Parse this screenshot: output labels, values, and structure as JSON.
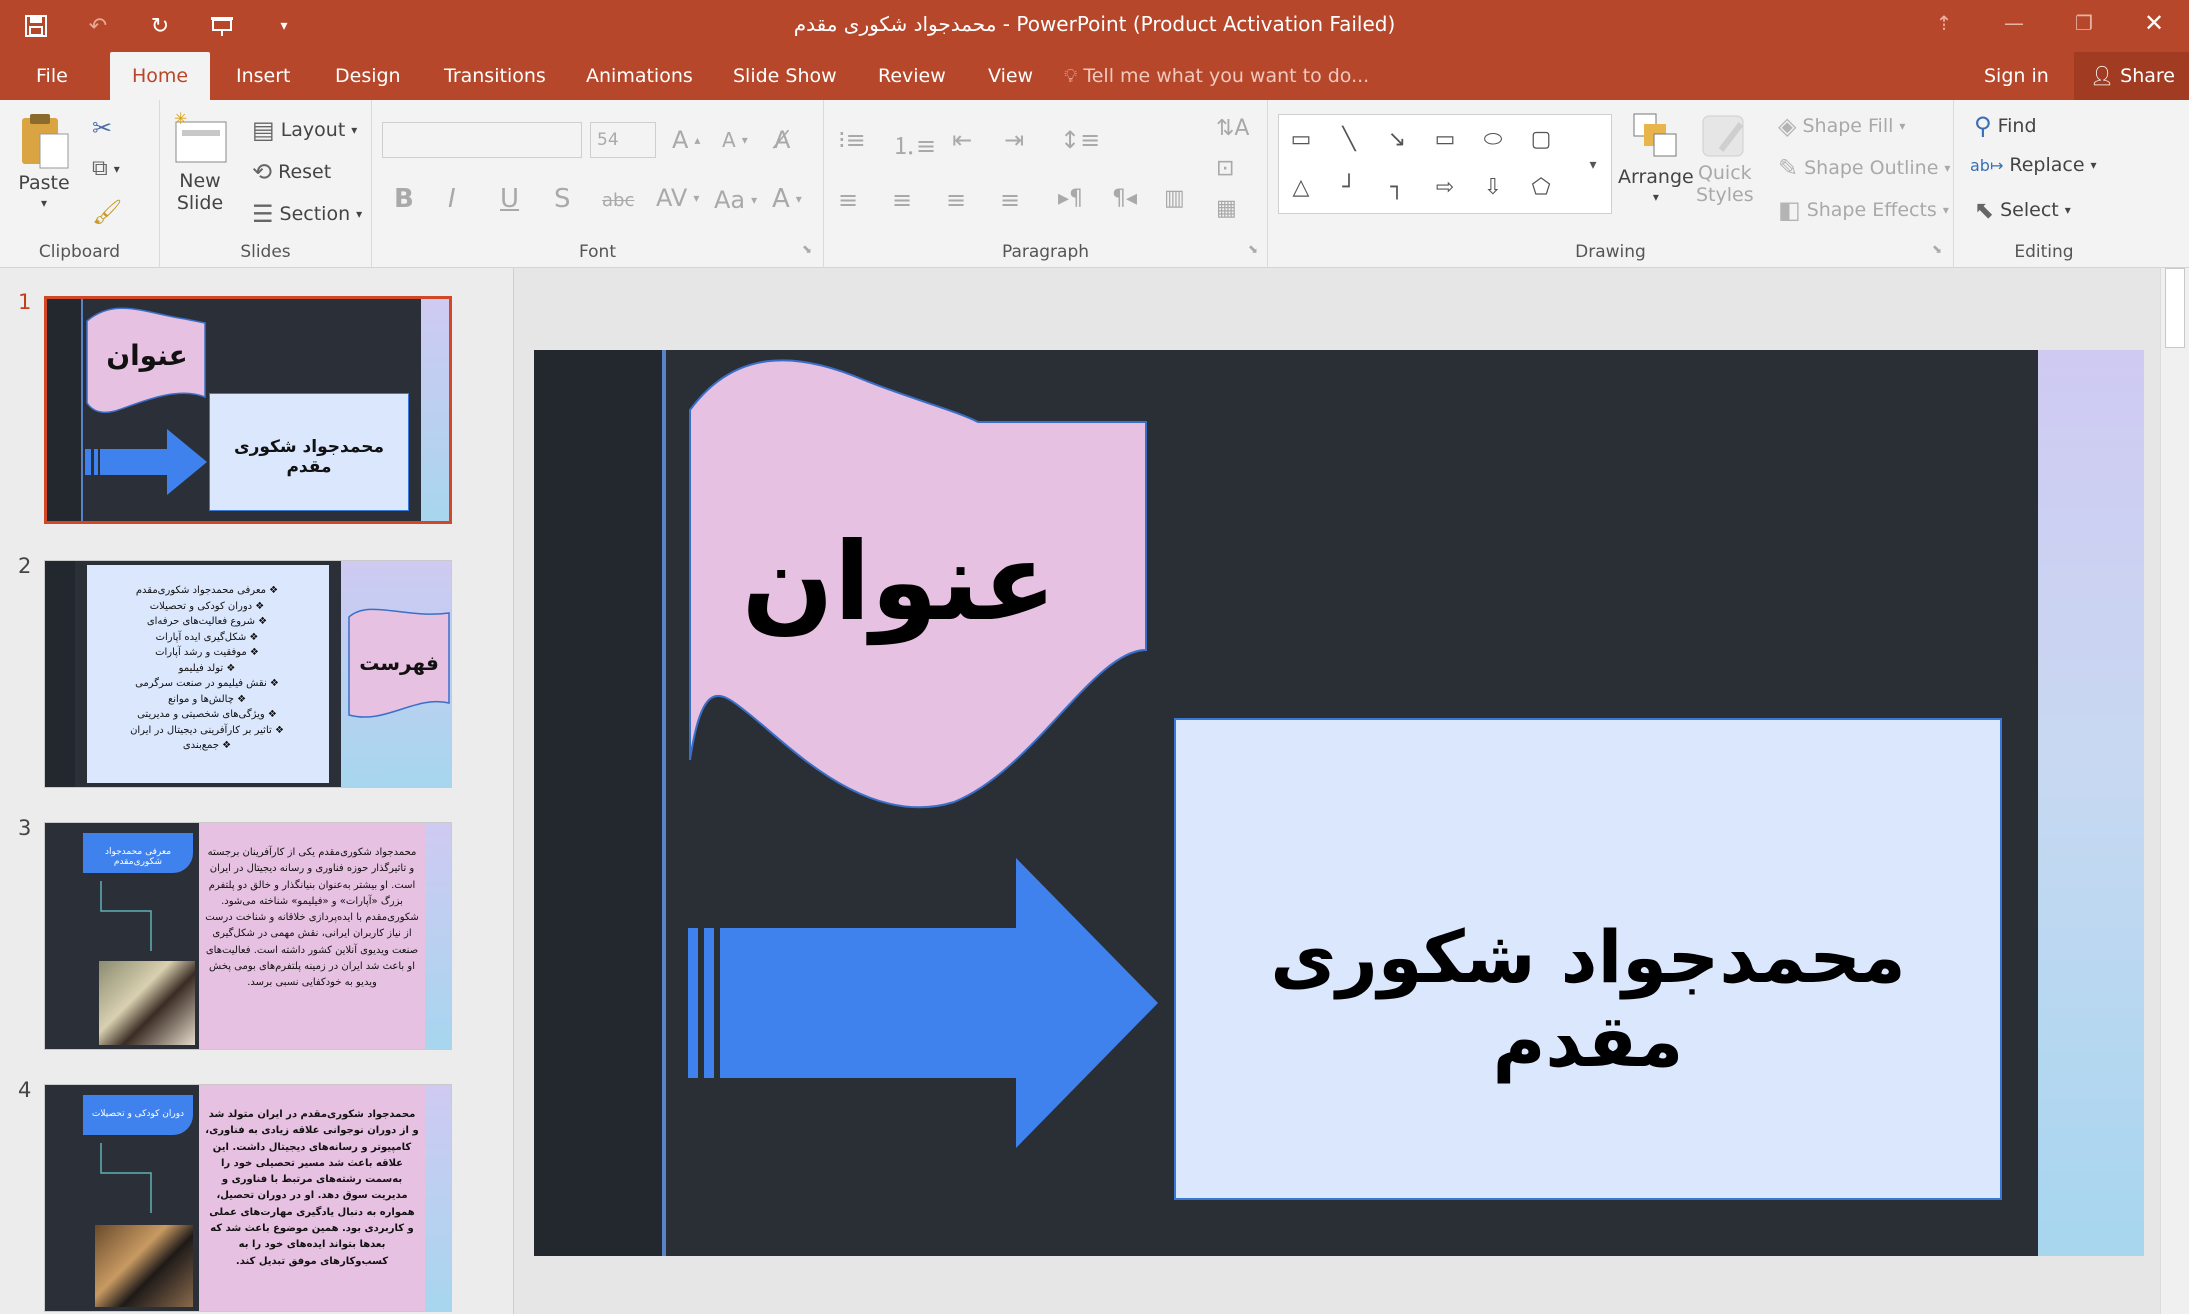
{
  "window": {
    "title": "محمدجواد شکوری مقدم - PowerPoint (Product Activation Failed)"
  },
  "qat": {
    "save_icon": "save-icon",
    "undo_icon": "undo-icon",
    "redo_icon": "redo-icon",
    "present_icon": "present-icon",
    "customize_icon": "customize-icon"
  },
  "tabs": {
    "file": "File",
    "home": "Home",
    "insert": "Insert",
    "design": "Design",
    "transitions": "Transitions",
    "animations": "Animations",
    "slide_show": "Slide Show",
    "review": "Review",
    "view": "View",
    "tell_me": "Tell me what you want to do...",
    "sign_in": "Sign in",
    "share": "Share"
  },
  "ribbon": {
    "clipboard": {
      "label": "Clipboard",
      "paste": "Paste"
    },
    "slides": {
      "label": "Slides",
      "new_slide_1": "New",
      "new_slide_2": "Slide",
      "layout": "Layout",
      "reset": "Reset",
      "section": "Section"
    },
    "font": {
      "label": "Font",
      "font_name": "",
      "font_size": "54"
    },
    "paragraph": {
      "label": "Paragraph"
    },
    "drawing": {
      "label": "Drawing",
      "arrange": "Arrange",
      "quick_styles_1": "Quick",
      "quick_styles_2": "Styles",
      "shape_fill": "Shape Fill",
      "shape_outline": "Shape Outline",
      "shape_effects": "Shape Effects"
    },
    "editing": {
      "label": "Editing",
      "find": "Find",
      "replace": "Replace",
      "select": "Select"
    }
  },
  "thumbnails": [
    {
      "number": "1",
      "title": "عنوان",
      "body": "محمدجواد شکوری مقدم"
    },
    {
      "number": "2",
      "title": "فهرست",
      "body": "❖ معرفی محمدجواد شکوری‌مقدم\n❖ دوران کودکی و تحصیلات\n❖ شروع فعالیت‌های حرفه‌ای\n❖ شکل‌گیری ایده آپارات\n❖ موفقیت و رشد آپارات\n❖ تولد فیلیمو\n❖ نقش فیلیمو در صنعت سرگرمی\n❖ چالش‌ها و موانع\n❖ ویژگی‌های شخصیتی و مدیریتی\n❖ تاثیر بر کارآفرینی دیجیتال در ایران\n❖ جمع‌بندی"
    },
    {
      "number": "3",
      "title": "معرفی محمدجواد شکوری‌مقدم",
      "body": "محمدجواد شکوری‌مقدم یکی از کارآفرینان برجسته و تاثیرگذار حوزه فناوری و رسانه دیجیتال در ایران است. او بیشتر به‌عنوان بنیانگذار و خالق دو پلتفرم بزرگ «آپارات» و «فیلیمو» شناخته می‌شود. شکوری‌مقدم با ایده‌پردازی خلاقانه و شناخت درست از نیاز کاربران ایرانی، نقش مهمی در شکل‌گیری صنعت ویدیوی آنلاین کشور داشته است. فعالیت‌های او باعث شد ایران در زمینه پلتفرم‌های بومی پخش ویدیو به خودکفایی نسبی برسد."
    },
    {
      "number": "4",
      "title": "دوران کودکی و تحصیلات",
      "body": "محمدجواد شکوری‌مقدم در ایران متولد شد و از دوران نوجوانی علاقه زیادی به فناوری، کامپیوتر و رسانه‌های دیجیتال داشت. این علاقه باعث شد مسیر تحصیلی خود را به‌سمت رشته‌های مرتبط با فناوری و مدیریت سوق دهد. او در دوران تحصیل، همواره به دنبال یادگیری مهارت‌های عملی و کاربردی بود. همین موضوع باعث شد که بعدها بتواند ایده‌های خود را به کسب‌وکارهای موفق تبدیل کند."
    }
  ],
  "slide": {
    "title": "عنوان",
    "name": "محمدجواد شکوری مقدم"
  }
}
